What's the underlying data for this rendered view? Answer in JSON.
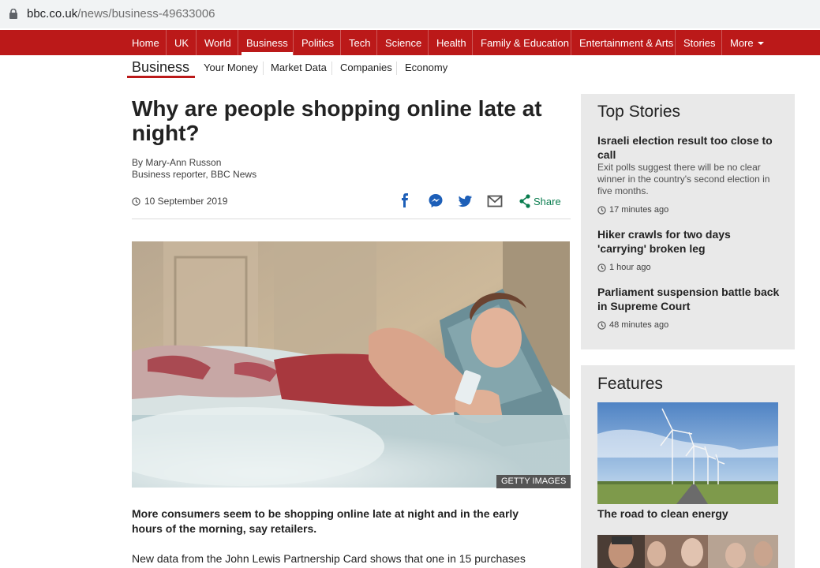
{
  "browser": {
    "url_domain": "bbc.co.uk",
    "url_path": "/news/business-49633006"
  },
  "nav": {
    "items": [
      "Home",
      "UK",
      "World",
      "Business",
      "Politics",
      "Tech",
      "Science",
      "Health",
      "Family & Education",
      "Entertainment & Arts",
      "Stories",
      "More"
    ],
    "active": "Business",
    "accent_color": "#bb1919"
  },
  "subnav": {
    "section": "Business",
    "links": [
      "Your Money",
      "Market Data",
      "Companies",
      "Economy"
    ]
  },
  "article": {
    "headline": "Why are people shopping online late at night?",
    "author": "By Mary-Ann Russon",
    "author_role": "Business reporter, BBC News",
    "date": "10 September 2019",
    "share_label": "Share",
    "image_credit": "GETTY IMAGES",
    "intro": "More consumers seem to be shopping online late at night and in the early hours of the morning, say retailers.",
    "paragraph": "New data from the John Lewis Partnership Card shows that one in 15 purchases"
  },
  "top_stories": {
    "title": "Top Stories",
    "items": [
      {
        "headline": "Israeli election result too close to call",
        "summary": "Exit polls suggest there will be no clear winner in the country's second election in five months.",
        "time": "17 minutes ago"
      },
      {
        "headline": "Hiker crawls for two days 'carrying' broken leg",
        "time": "1 hour ago"
      },
      {
        "headline": "Parliament suspension battle back in Supreme Court",
        "time": "48 minutes ago"
      }
    ]
  },
  "features": {
    "title": "Features",
    "items": [
      {
        "headline": "The road to clean energy",
        "image": "wind-turbines-image"
      },
      {
        "headline": "",
        "image": "crowd-image"
      }
    ]
  },
  "icons": {
    "clock": "clock-icon",
    "lock": "lock-icon",
    "facebook": "facebook-icon",
    "messenger": "messenger-icon",
    "twitter": "twitter-icon",
    "email": "email-icon",
    "share": "share-icon"
  },
  "colors": {
    "share_green": "#0a7d4f",
    "social_blue": "#1d5fb8",
    "panel_grey": "#e9e9e9"
  }
}
